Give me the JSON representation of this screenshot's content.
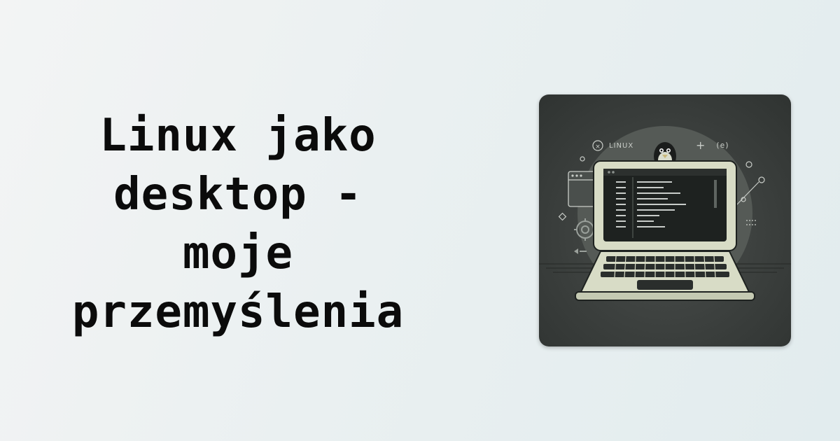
{
  "title": {
    "lines": [
      "Linux jako",
      "desktop -",
      "moje",
      "przemyślenia"
    ]
  },
  "illustration": {
    "brand_label": "LINUX",
    "corner_symbol": "(e)",
    "icon": "laptop-terminal-illustration"
  },
  "colors": {
    "title": "#0b0b0b",
    "card_bg": "#3b3f3d",
    "laptop_body": "#d8dcc6",
    "screen_bg": "#1e2220",
    "accent_circle": "#565a57"
  }
}
